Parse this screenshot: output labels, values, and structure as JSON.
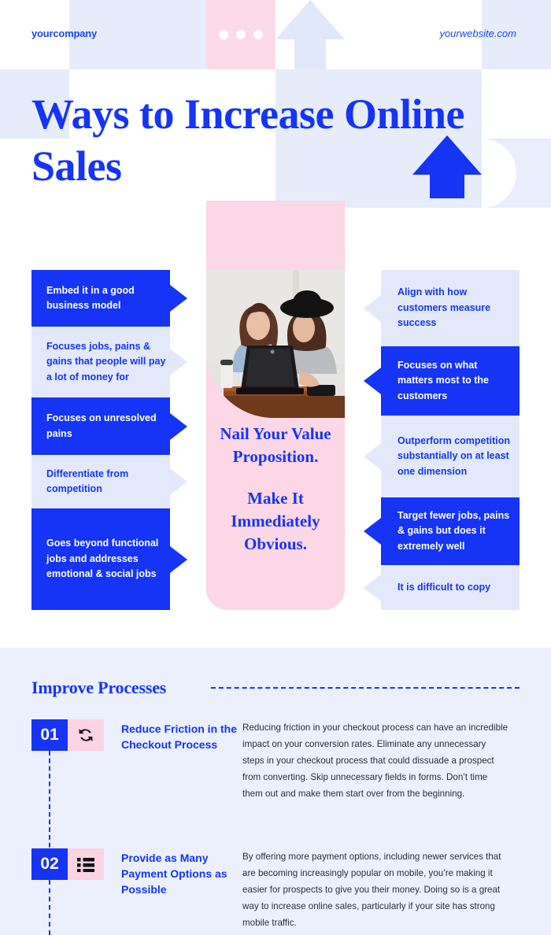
{
  "header": {
    "company": "yourcompany",
    "website": "yourwebsite.com",
    "title": "Ways to Increase Online Sales"
  },
  "colors": {
    "brand_blue": "#1634f5",
    "pale_blue": "#e3e9fb",
    "pink": "#fcd7e6",
    "section_bg": "#ecf0fd"
  },
  "center": {
    "line1": "Nail Your Value Proposition.",
    "line2": "Make It Immediately Obvious.",
    "photo_alt": "two-women-working-on-laptop-photo"
  },
  "left_column": [
    {
      "text": "Embed it in a good business model",
      "style": "blue"
    },
    {
      "text": "Focuses jobs, pains & gains that people will pay a lot of money for",
      "style": "pale"
    },
    {
      "text": "Focuses on unresolved pains",
      "style": "blue"
    },
    {
      "text": "Differentiate from competition",
      "style": "pale"
    },
    {
      "text": "Goes beyond functional jobs and addresses emotional & social jobs",
      "style": "blue"
    }
  ],
  "right_column": [
    {
      "text": "Align with how customers measure success",
      "style": "pale"
    },
    {
      "text": "Focuses on what matters most to the customers",
      "style": "blue"
    },
    {
      "text": "Outperform competition substantially on at least one dimension",
      "style": "pale"
    },
    {
      "text": "Target fewer jobs, pains & gains but does it extremely well",
      "style": "blue"
    },
    {
      "text": "It is difficult to copy",
      "style": "pale"
    }
  ],
  "section": {
    "title": "Improve Processes",
    "steps": [
      {
        "number": "01",
        "icon": "refresh-cycle-icon",
        "heading": "Reduce Friction in the Checkout Process",
        "body": "Reducing friction in your checkout process can have an incredible impact on your conversion rates. Eliminate any unnecessary steps in your checkout process that could dissuade a prospect from converting. Skip unnecessary fields in forms. Don’t time them out and make them start over from the beginning."
      },
      {
        "number": "02",
        "icon": "list-items-icon",
        "heading": "Provide as Many Payment Options as Possible",
        "body": "By offering more payment options, including newer services that are becoming increasingly popular on mobile, you’re making it easier for prospects to give you their money. Doing so is a great way to increase online sales, particularly if your site has strong mobile traffic."
      }
    ]
  }
}
